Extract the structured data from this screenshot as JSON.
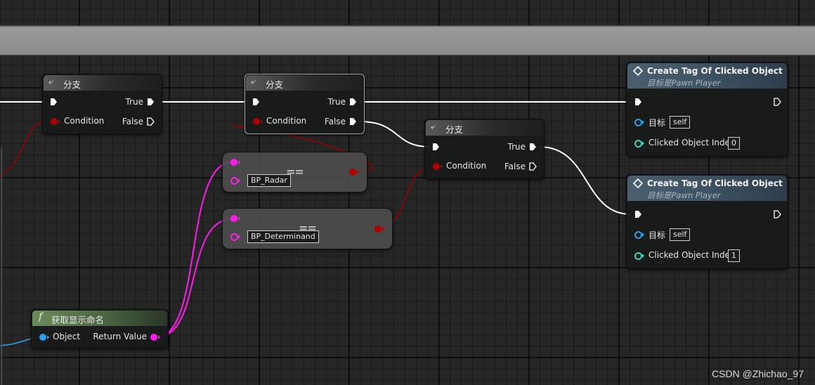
{
  "branch_nodes": [
    {
      "title": "分支",
      "pins": {
        "true": "True",
        "condition": "Condition",
        "false": "False"
      }
    },
    {
      "title": "分支",
      "pins": {
        "true": "True",
        "condition": "Condition",
        "false": "False"
      }
    },
    {
      "title": "分支",
      "pins": {
        "true": "True",
        "condition": "Condition",
        "false": "False"
      }
    }
  ],
  "compare_nodes": [
    {
      "op": "==",
      "value": "BP_Radar"
    },
    {
      "op": "==",
      "value": "BP_Determinand"
    }
  ],
  "func_node": {
    "title": "获取显示命名",
    "input": "Object",
    "output": "Return Value"
  },
  "create_tag_nodes": [
    {
      "title": "Create Tag Of Clicked Object",
      "subtitle": "目标是Pawn Player",
      "target_label": "目标",
      "target_value": "self",
      "index_label": "Clicked Object Index",
      "index_value": "0"
    },
    {
      "title": "Create Tag Of Clicked Object",
      "subtitle": "目标是Pawn Player",
      "target_label": "目标",
      "target_value": "self",
      "index_label": "Clicked Object Index",
      "index_value": "1"
    }
  ],
  "watermark": "CSDN @Zhichao_97",
  "colors": {
    "exec": "#ffffff",
    "bool": "#b00000",
    "string": "#ff1ce8",
    "object": "#2aa0f0",
    "int": "#3ad8bc"
  },
  "icons": {
    "branch": "branch-icon",
    "function": "function-icon",
    "event": "event-diamond-icon"
  }
}
